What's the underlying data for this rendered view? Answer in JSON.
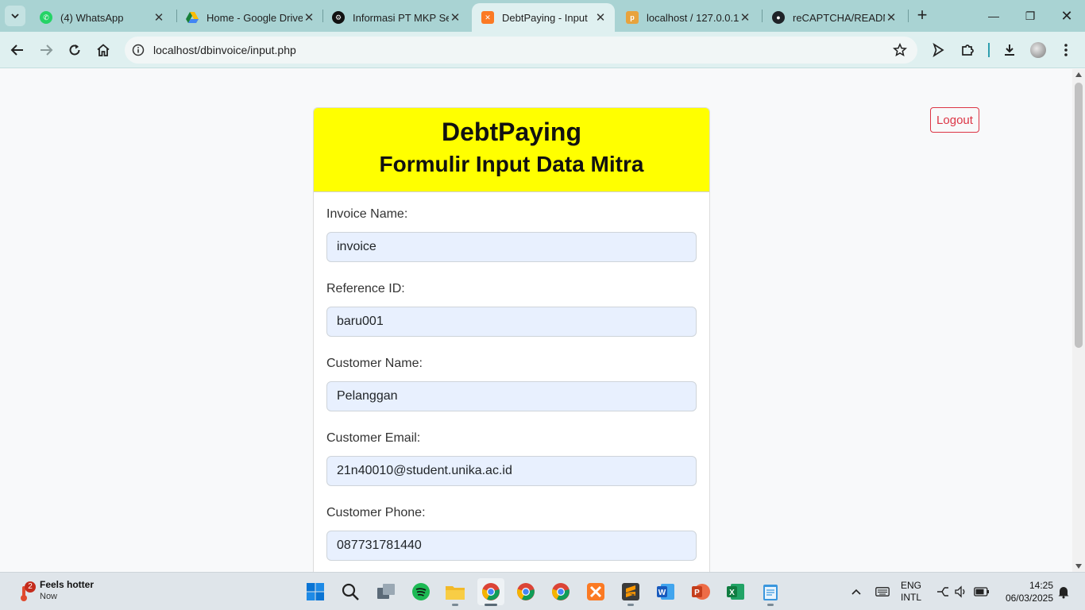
{
  "browser": {
    "tabs": [
      {
        "title": "(4) WhatsApp",
        "icon": "whatsapp-icon",
        "active": false
      },
      {
        "title": "Home - Google Drive",
        "icon": "google-drive-icon",
        "active": false
      },
      {
        "title": "Informasi PT MKP Ser",
        "icon": "openai-icon",
        "active": false
      },
      {
        "title": "DebtPaying - Input",
        "icon": "xampp-icon",
        "active": true
      },
      {
        "title": "localhost / 127.0.0.1:3",
        "icon": "phpmyadmin-icon",
        "active": false
      },
      {
        "title": "reCAPTCHA/READM",
        "icon": "github-icon",
        "active": false
      }
    ],
    "url": "localhost/dbinvoice/input.php"
  },
  "page": {
    "logout_label": "Logout",
    "title": "DebtPaying",
    "subtitle": "Formulir Input Data Mitra",
    "fields": [
      {
        "label": "Invoice Name:",
        "value": "invoice"
      },
      {
        "label": "Reference ID:",
        "value": "baru001"
      },
      {
        "label": "Customer Name:",
        "value": "Pelanggan"
      },
      {
        "label": "Customer Email:",
        "value": "21n40010@student.unika.ac.id"
      },
      {
        "label": "Customer Phone:",
        "value": "087731781440"
      }
    ]
  },
  "taskbar": {
    "weather_title": "Feels hotter",
    "weather_sub": "Now",
    "notification_count": "2",
    "lang_top": "ENG",
    "lang_bottom": "INTL",
    "time": "14:25",
    "date": "06/03/2025"
  },
  "colors": {
    "header_bg": "#ffff00",
    "input_bg": "#e8f0fe",
    "logout": "#dc3545",
    "tabbar": "#a9d3d3",
    "toolbar": "#dff0f0"
  }
}
